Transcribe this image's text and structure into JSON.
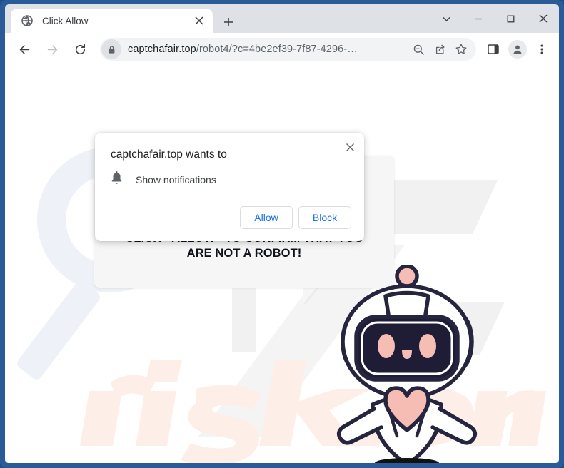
{
  "window": {
    "controls": [
      {
        "name": "tab-search",
        "icon": "chevron-down-icon"
      },
      {
        "name": "minimize",
        "icon": "minimize-icon"
      },
      {
        "name": "maximize",
        "icon": "maximize-icon"
      },
      {
        "name": "close",
        "icon": "close-icon"
      }
    ],
    "border_color": "#2a5a97"
  },
  "tabstrip": {
    "tab": {
      "title": "Click Allow",
      "favicon": "globe-icon",
      "close_label": "×"
    },
    "new_tab_label": "+"
  },
  "toolbar": {
    "back": "←",
    "forward": "→",
    "reload": "⟳",
    "lock_icon": "lock-icon",
    "url_domain": "captchafair.top",
    "url_path": "/robot4/?c=4be2ef39-7f87-4296-…",
    "icons": [
      {
        "name": "zoom-out-icon"
      },
      {
        "name": "share-icon"
      },
      {
        "name": "bookmark-star-icon"
      },
      {
        "name": "side-panel-icon"
      },
      {
        "name": "profile-avatar-icon"
      },
      {
        "name": "more-menu-icon"
      }
    ]
  },
  "permission_dialog": {
    "title": "captchafair.top wants to",
    "permission_icon": "bell-icon",
    "permission_label": "Show notifications",
    "allow_label": "Allow",
    "block_label": "Block",
    "close_label": "×",
    "accent_color": "#1a73e8"
  },
  "page": {
    "bubble_text_line1": "CLICK «ALLOW» TO CONFIRM THAT YOU",
    "bubble_text_line2": "ARE NOT A ROBOT!",
    "watermark_text": "risk.com",
    "robot": {
      "name": "robot-mascot",
      "outline_color": "#262540",
      "accent_color": "#f5bdb3",
      "body_color": "#ffffff"
    }
  }
}
